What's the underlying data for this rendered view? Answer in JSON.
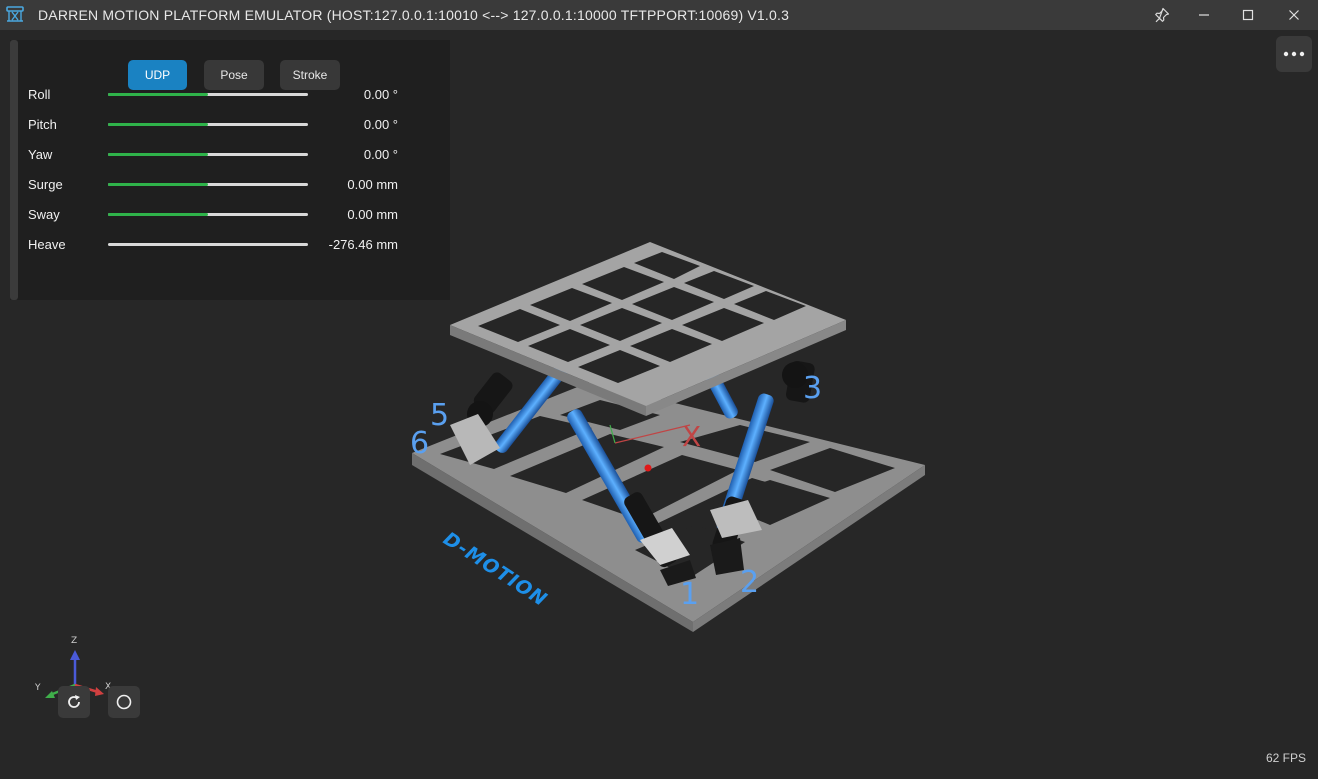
{
  "window": {
    "title": "DARREN MOTION PLATFORM EMULATOR (HOST:127.0.0.1:10010 <--> 127.0.0.1:10000 TFTPPORT:10069) V1.0.3",
    "icons": [
      "app-logo-icon",
      "pin-icon",
      "minimize-icon",
      "maximize-icon",
      "close-icon"
    ]
  },
  "modes": {
    "udp": "UDP",
    "pose": "Pose",
    "stroke": "Stroke",
    "active": "UDP"
  },
  "dof": [
    {
      "label": "Roll",
      "value": "0.00 °",
      "level": 0.5
    },
    {
      "label": "Pitch",
      "value": "0.00 °",
      "level": 0.5
    },
    {
      "label": "Yaw",
      "value": "0.00 °",
      "level": 0.5
    },
    {
      "label": "Surge",
      "value": "0.00 mm",
      "level": 0.5
    },
    {
      "label": "Sway",
      "value": "0.00 mm",
      "level": 0.5
    },
    {
      "label": "Heave",
      "value": "-276.46 mm",
      "level": 0.0
    }
  ],
  "scene": {
    "brand": "D-MOTION",
    "actuator_labels": [
      "1",
      "2",
      "3",
      "5",
      "6"
    ],
    "axis_x": "X",
    "gizmo": {
      "z": "Z",
      "y": "Y",
      "x": "X"
    },
    "colors": {
      "actuator": "#3a8ee8",
      "frame": "#9a9a9a",
      "label": "#5aa0f0",
      "axis_x": "#d04040",
      "axis_y": "#3fae4a",
      "axis_z": "#4a5ad8"
    }
  },
  "controls": {
    "icons": [
      "more-options-icon",
      "reset-view-icon",
      "circle-view-icon"
    ]
  },
  "status": {
    "fps": "62 FPS"
  }
}
